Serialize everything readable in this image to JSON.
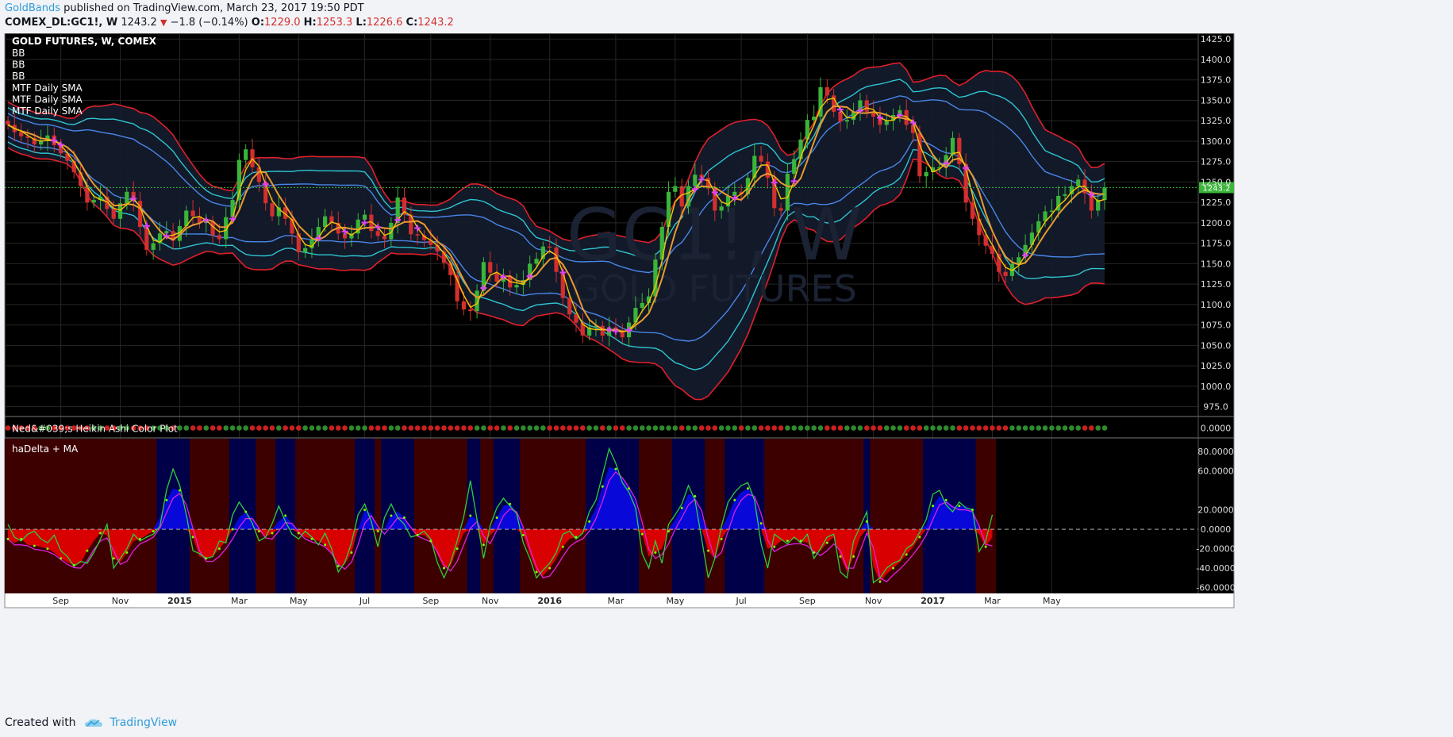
{
  "header": {
    "author": "GoldBands",
    "published": " published on TradingView.com, March 23, 2017 19:50 PDT",
    "symbol": "COMEX_DL:GC1!, W",
    "price": "1243.2",
    "change": "−1.8 (−0.14%)",
    "o_label": "O:",
    "o_val": "1229.0",
    "h_label": "H:",
    "h_val": "1253.3",
    "l_label": "L:",
    "l_val": "1226.6",
    "c_label": "C:",
    "c_val": "1243.2"
  },
  "footer": {
    "created_with": "Created with",
    "brand": "TradingView"
  },
  "colors": {
    "background": "#000000",
    "panel_bg": "#141c2e",
    "bb_outer": "#e0202a",
    "bb_mid": "#2ec5d0",
    "bb_inner": "#4a86e8",
    "up": "#3ab53a",
    "down": "#d32f2f",
    "sma_fast": "#f5c500",
    "sma_slow": "#e89a30",
    "cross": "#e040fb",
    "bear_bg": "#3d0000",
    "bull_bg": "#000048",
    "hist_pos": "#0808d8",
    "hist_neg": "#d80000",
    "line_green": "#2ecc40",
    "line_magenta": "#e020e0"
  },
  "chart_data": [
    {
      "type": "candlestick",
      "title": "GOLD FUTURES, W, COMEX",
      "legend": [
        "BB",
        "BB",
        "BB",
        "MTF Daily SMA",
        "MTF Daily SMA",
        "MTF Daily SMA"
      ],
      "watermark": [
        "GC1!, W",
        "GOLD FUTURES"
      ],
      "x_ticks": [
        {
          "label": "Sep",
          "week": 8
        },
        {
          "label": "Nov",
          "week": 17
        },
        {
          "label": "2015",
          "week": 26
        },
        {
          "label": "Mar",
          "week": 35
        },
        {
          "label": "May",
          "week": 44
        },
        {
          "label": "Jul",
          "week": 54
        },
        {
          "label": "Sep",
          "week": 64
        },
        {
          "label": "Nov",
          "week": 73
        },
        {
          "label": "2016",
          "week": 82
        },
        {
          "label": "Mar",
          "week": 92
        },
        {
          "label": "May",
          "week": 101
        },
        {
          "label": "Jul",
          "week": 111
        },
        {
          "label": "Sep",
          "week": 121
        },
        {
          "label": "Nov",
          "week": 131
        },
        {
          "label": "2017",
          "week": 140
        },
        {
          "label": "Mar",
          "week": 149
        },
        {
          "label": "May",
          "week": 158
        }
      ],
      "y_ticks": [
        "1425.0",
        "1400.0",
        "1375.0",
        "1350.0",
        "1325.0",
        "1300.0",
        "1275.0",
        "1250.0",
        "1225.0",
        "1200.0",
        "1175.0",
        "1150.0",
        "1125.0",
        "1100.0",
        "1075.0",
        "1050.0",
        "1025.0",
        "1000.0",
        "975.0"
      ],
      "ylim": [
        963,
        1432
      ],
      "last_price": "1243.2",
      "close": [
        1320,
        1311,
        1306,
        1304,
        1296,
        1300,
        1307,
        1295,
        1285,
        1276,
        1262,
        1245,
        1225,
        1228,
        1232,
        1217,
        1205,
        1224,
        1238,
        1227,
        1195,
        1167,
        1175,
        1187,
        1190,
        1178,
        1196,
        1215,
        1208,
        1200,
        1202,
        1185,
        1180,
        1207,
        1228,
        1277,
        1290,
        1268,
        1250,
        1224,
        1208,
        1219,
        1205,
        1187,
        1164,
        1169,
        1180,
        1195,
        1208,
        1200,
        1187,
        1181,
        1187,
        1204,
        1210,
        1190,
        1184,
        1180,
        1200,
        1231,
        1210,
        1186,
        1185,
        1179,
        1173,
        1165,
        1151,
        1136,
        1104,
        1094,
        1092,
        1117,
        1152,
        1139,
        1128,
        1135,
        1121,
        1124,
        1130,
        1150,
        1156,
        1171,
        1170,
        1140,
        1108,
        1088,
        1078,
        1062,
        1072,
        1074,
        1062,
        1072,
        1068,
        1060,
        1078,
        1096,
        1102,
        1110,
        1155,
        1195,
        1238,
        1245,
        1220,
        1245,
        1259,
        1255,
        1242,
        1215,
        1220,
        1233,
        1238,
        1235,
        1255,
        1282,
        1275,
        1255,
        1218,
        1215,
        1260,
        1278,
        1302,
        1326,
        1330,
        1366,
        1356,
        1336,
        1324,
        1326,
        1336,
        1350,
        1336,
        1330,
        1320,
        1325,
        1332,
        1338,
        1320,
        1310,
        1257,
        1262,
        1268,
        1268,
        1283,
        1304,
        1272,
        1225,
        1205,
        1185,
        1172,
        1162,
        1140,
        1135,
        1150,
        1158,
        1173,
        1188,
        1202,
        1214,
        1215,
        1233,
        1235,
        1245,
        1253,
        1236,
        1215,
        1228,
        1243.2
      ],
      "open_first": 1325
    },
    {
      "type": "dots",
      "title": "Ned&#039;s Heikin Ashi Color Plot",
      "y_tick": "0.0000",
      "colors": "per-bar red/green"
    },
    {
      "type": "histogram",
      "title": "haDelta + MA",
      "y_ticks": [
        "80.0000",
        "60.0000",
        "20.0000",
        "0.0000",
        "-20.0000",
        "-40.0000",
        "-60.0000"
      ],
      "ylim": [
        -66,
        94
      ],
      "delta": [
        5,
        -8,
        -12,
        -5,
        -2,
        -10,
        -14,
        -6,
        -22,
        -28,
        -38,
        -33,
        -35,
        -24,
        -10,
        5,
        -40,
        -30,
        -20,
        -5,
        -12,
        -8,
        -5,
        3,
        40,
        62,
        45,
        15,
        -22,
        -25,
        -30,
        -28,
        -12,
        -14,
        15,
        28,
        18,
        6,
        -12,
        -8,
        6,
        24,
        8,
        -5,
        -10,
        -2,
        -8,
        -16,
        -4,
        -20,
        -44,
        -34,
        -14,
        15,
        26,
        8,
        -18,
        12,
        26,
        12,
        5,
        -8,
        -6,
        -2,
        -10,
        -34,
        -50,
        -34,
        -12,
        13,
        50,
        10,
        -30,
        4,
        22,
        32,
        24,
        16,
        -14,
        -30,
        -50,
        -42,
        -35,
        -24,
        -5,
        -2,
        -10,
        -4,
        18,
        30,
        56,
        83,
        68,
        48,
        38,
        22,
        -25,
        -40,
        -12,
        -35,
        5,
        15,
        26,
        45,
        30,
        -10,
        -50,
        -30,
        3,
        28,
        38,
        45,
        48,
        30,
        -15,
        -40,
        -5,
        -10,
        -15,
        -8,
        -14,
        -5,
        -30,
        -20,
        -8,
        -5,
        -44,
        -50,
        -12,
        3,
        18,
        -55,
        -50,
        -40,
        -35,
        -32,
        -20,
        -15,
        -3,
        10,
        36,
        40,
        25,
        18,
        28,
        22,
        20,
        -23,
        -12,
        15
      ],
      "ma": [
        -10,
        -14,
        -10,
        -16,
        -17,
        -18,
        -20,
        -24,
        -30,
        -34,
        -37,
        -35,
        -22,
        -12,
        -4,
        -6,
        -30,
        -34,
        -24,
        -12,
        -10,
        -6,
        -2,
        12,
        30,
        42,
        40,
        18,
        -8,
        -28,
        -30,
        -28,
        -20,
        -12,
        0,
        12,
        18,
        12,
        -2,
        -8,
        -4,
        8,
        14,
        6,
        -4,
        -8,
        -10,
        -12,
        -16,
        -26,
        -38,
        -36,
        -24,
        0,
        20,
        16,
        -2,
        0,
        14,
        18,
        12,
        0,
        -6,
        -6,
        -12,
        -26,
        -40,
        -38,
        -20,
        -4,
        14,
        10,
        -16,
        -6,
        12,
        24,
        26,
        18,
        -6,
        -26,
        -44,
        -48,
        -40,
        -30,
        -18,
        -10,
        -8,
        -4,
        8,
        22,
        44,
        64,
        62,
        52,
        42,
        28,
        -5,
        -28,
        -24,
        -20,
        -2,
        10,
        22,
        36,
        34,
        12,
        -22,
        -30,
        -10,
        14,
        30,
        38,
        42,
        34,
        6,
        -20,
        -18,
        -12,
        -12,
        -10,
        -12,
        -14,
        -24,
        -22,
        -14,
        -8,
        -28,
        -44,
        -28,
        -8,
        8,
        -38,
        -54,
        -46,
        -40,
        -34,
        -26,
        -18,
        -8,
        4,
        24,
        34,
        30,
        24,
        24,
        24,
        20,
        -5,
        -18,
        -8
      ]
    }
  ]
}
